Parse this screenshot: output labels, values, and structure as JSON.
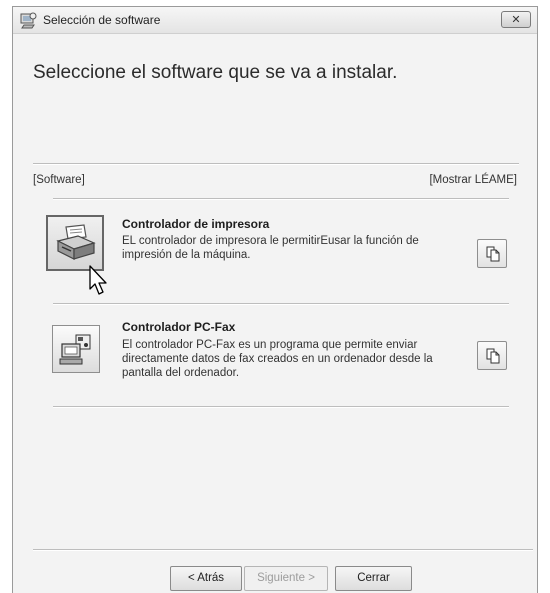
{
  "window": {
    "title": "Selección de software",
    "close_glyph": "✕"
  },
  "heading": "Seleccione el software que se va a instalar.",
  "list_header": {
    "software_label": "[Software]",
    "readme_label": "[Mostrar LÉAME]"
  },
  "items": [
    {
      "title": "Controlador de impresora",
      "description": "EL controlador de impresora le permitirEusar la función de impresión de la máquina.",
      "icon": "printer-icon",
      "readme_icon": "document-icon"
    },
    {
      "title": "Controlador PC-Fax",
      "description": "El controlador PC-Fax es un programa que permite enviar directamente datos de fax creados en un ordenador desde la pantalla del ordenador.",
      "icon": "pc-fax-icon",
      "readme_icon": "document-icon"
    }
  ],
  "buttons": {
    "back": "< Atrás",
    "next": "Siguiente >",
    "close": "Cerrar"
  },
  "colors": {
    "window_bg": "#f3f3f3",
    "text": "#333333",
    "disabled_text": "#9c9c9c"
  }
}
